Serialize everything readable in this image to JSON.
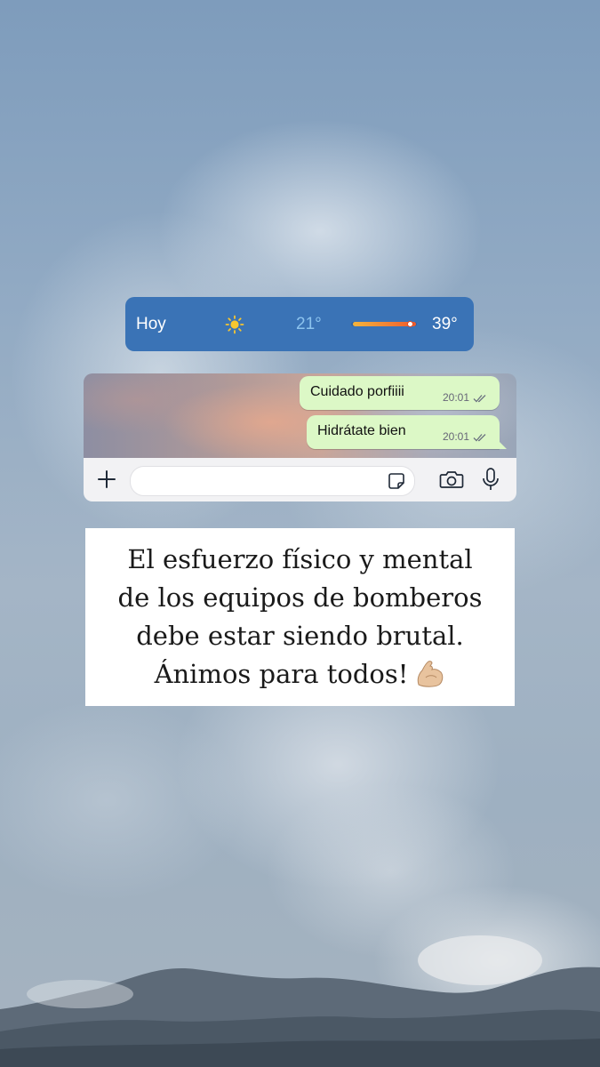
{
  "weather": {
    "day": "Hoy",
    "icon": "sun-icon",
    "low": "21°",
    "high": "39°",
    "current_fraction": 0.88
  },
  "chat": {
    "messages": [
      {
        "text": "Cuidado porfiiii",
        "time": "20:01",
        "status": "read"
      },
      {
        "text": "Hidrátate bien",
        "time": "20:01",
        "status": "read"
      }
    ],
    "input_placeholder": "",
    "icons": [
      "plus-icon",
      "sticker-icon",
      "camera-icon",
      "microphone-icon"
    ]
  },
  "caption": {
    "lines": [
      "El esfuerzo físico y mental",
      "de los equipos de bomberos",
      "debe estar siendo brutal.",
      "Ánimos para todos!"
    ],
    "emoji": "flexed-biceps-icon"
  },
  "colors": {
    "weather_bg": "#3a73b6",
    "bubble_bg": "#dcf8c6",
    "caption_bg": "#ffffff"
  }
}
